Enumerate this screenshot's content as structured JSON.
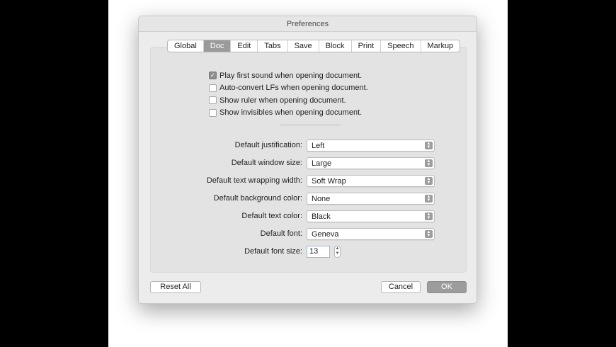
{
  "window": {
    "title": "Preferences"
  },
  "tabs": [
    "Global",
    "Doc",
    "Edit",
    "Tabs",
    "Save",
    "Block",
    "Print",
    "Speech",
    "Markup"
  ],
  "active_tab": "Doc",
  "checkboxes": [
    {
      "label": "Play first sound when opening document.",
      "checked": true
    },
    {
      "label": "Auto-convert LFs when opening document.",
      "checked": false
    },
    {
      "label": "Show ruler when opening document.",
      "checked": false
    },
    {
      "label": "Show invisibles when opening document.",
      "checked": false
    }
  ],
  "fields": {
    "justification": {
      "label": "Default justification:",
      "value": "Left"
    },
    "window_size": {
      "label": "Default window size:",
      "value": "Large"
    },
    "wrap_width": {
      "label": "Default text wrapping width:",
      "value": "Soft Wrap"
    },
    "bg_color": {
      "label": "Default background color:",
      "value": "None"
    },
    "text_color": {
      "label": "Default text color:",
      "value": "Black"
    },
    "font": {
      "label": "Default font:",
      "value": "Geneva"
    },
    "font_size": {
      "label": "Default font size:",
      "value": "13"
    }
  },
  "buttons": {
    "reset": "Reset All",
    "cancel": "Cancel",
    "ok": "OK"
  },
  "icons": {
    "check": "✓",
    "arrow_up": "▲",
    "arrow_down": "▼"
  }
}
